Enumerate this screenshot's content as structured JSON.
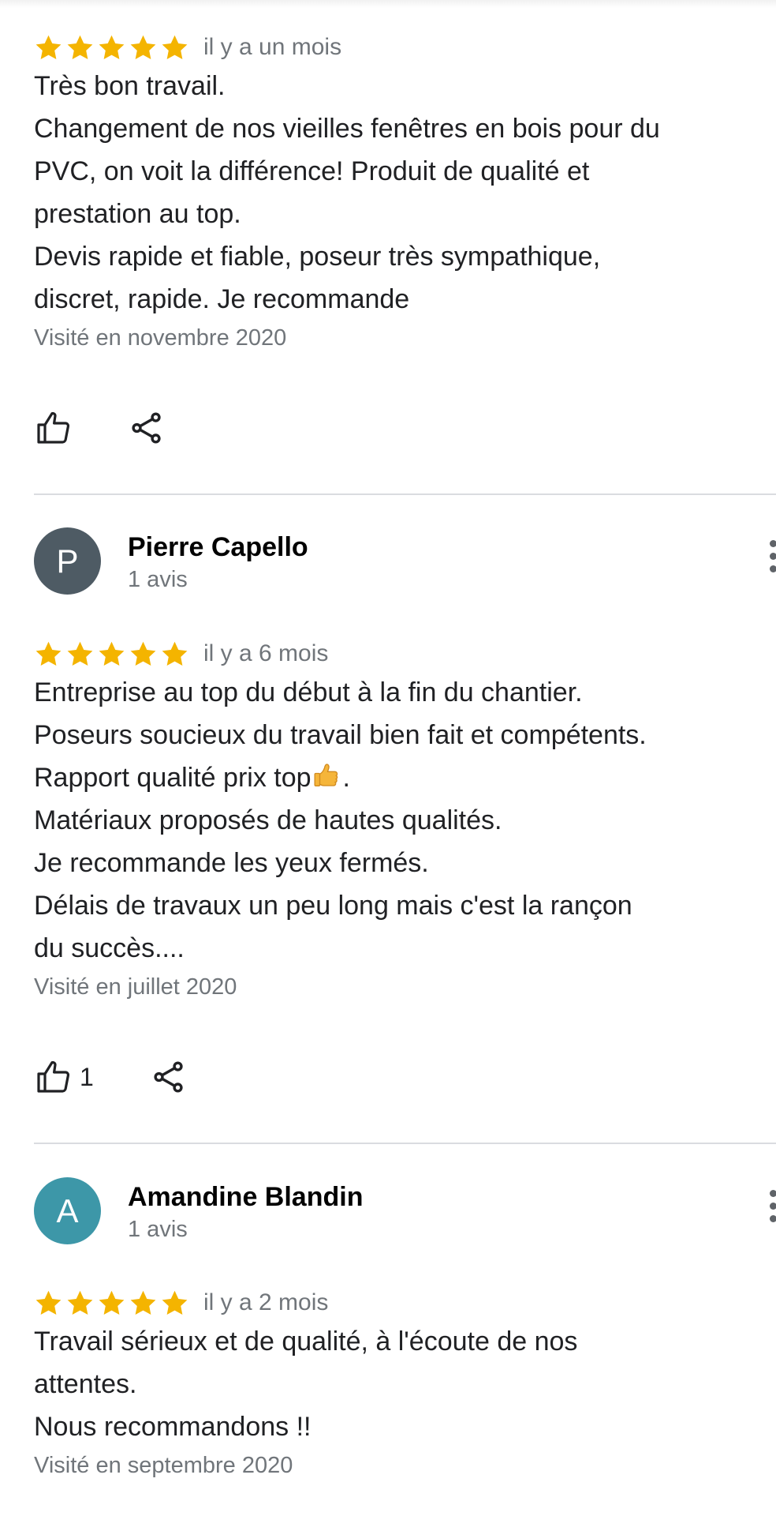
{
  "colors": {
    "star": "#f4b400",
    "avatar_p": "#4e5b64",
    "avatar_a": "#3d97a8",
    "secondary_text": "#70757a",
    "divider": "#dadce0"
  },
  "reviews": [
    {
      "author": null,
      "rating": 5,
      "date": "il y a un mois",
      "lines": [
        "Très bon travail.",
        "Changement de nos vieilles fenêtres en bois pour du",
        "PVC, on voit la différence! Produit de qualité et",
        "prestation au top.",
        "Devis rapide et fiable, poseur très sympathique,",
        "discret, rapide. Je recommande"
      ],
      "visited": "Visité en novembre 2020",
      "like_icon": "thumbs-up-icon",
      "share_icon": "share-icon"
    },
    {
      "author": {
        "initial": "P",
        "name": "Pierre Capello",
        "count": "1 avis"
      },
      "rating": 5,
      "date": "il y a 6 mois",
      "lines": [
        "Entreprise au top du début à la fin du chantier.",
        "Poseurs soucieux du travail bien fait et compétents.",
        "Rapport qualité prix top",
        "Matériaux proposés de hautes qualités.",
        "Je recommande les yeux fermés.",
        "Délais de travaux un peu long mais c'est la rançon",
        "du succès...."
      ],
      "line3_suffix": ".",
      "visited": "Visité en juillet 2020",
      "likes": "1",
      "like_icon": "thumbs-up-icon",
      "share_icon": "share-icon"
    },
    {
      "author": {
        "initial": "A",
        "name": "Amandine Blandin",
        "count": "1 avis"
      },
      "rating": 5,
      "date": "il y a 2 mois",
      "lines": [
        "Travail sérieux et de qualité, à l'écoute de nos",
        "attentes.",
        "Nous recommandons !!"
      ],
      "visited": "Visité en septembre 2020"
    }
  ]
}
